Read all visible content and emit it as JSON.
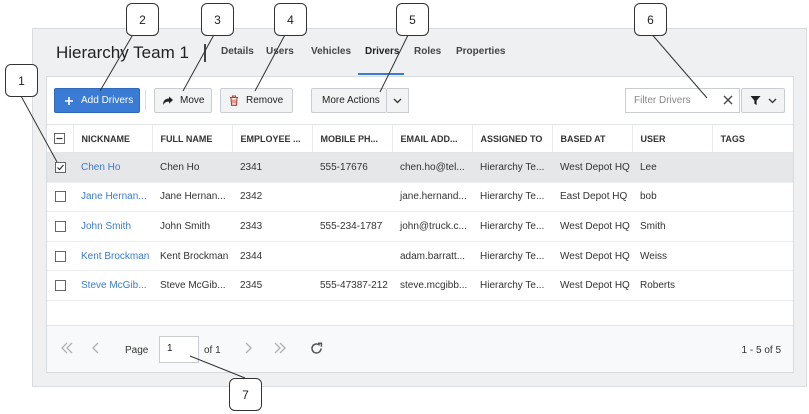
{
  "page": {
    "title": "Hierarchy Team 1"
  },
  "tabs": [
    {
      "label": "Details"
    },
    {
      "label": "Users"
    },
    {
      "label": "Vehicles"
    },
    {
      "label": "Drivers"
    },
    {
      "label": "Roles"
    },
    {
      "label": "Properties"
    }
  ],
  "toolbar": {
    "add_label": "Add Drivers",
    "move_label": "Move",
    "remove_label": "Remove",
    "more_label": "More Actions",
    "filter_placeholder": "Filter Drivers"
  },
  "table": {
    "columns": [
      "NICKNAME",
      "FULL NAME",
      "EMPLOYEE ...",
      "MOBILE PH...",
      "EMAIL ADD...",
      "ASSIGNED TO",
      "BASED AT",
      "USER",
      "TAGS"
    ],
    "rows": [
      {
        "nickname": "Chen Ho",
        "full_name": "Chen Ho",
        "employee": "2341",
        "mobile": "555-17676",
        "email": "chen.ho@tel...",
        "assigned": "Hierarchy Te...",
        "based": "West Depot HQ",
        "user": "Lee",
        "tags": "",
        "checked": true
      },
      {
        "nickname": "Jane Hernan...",
        "full_name": "Jane Hernan...",
        "employee": "2342",
        "mobile": "",
        "email": "jane.hernand...",
        "assigned": "Hierarchy Te...",
        "based": "East Depot HQ",
        "user": "bob",
        "tags": "",
        "checked": false
      },
      {
        "nickname": "John Smith",
        "full_name": "John Smith",
        "employee": "2343",
        "mobile": "555-234-1787",
        "email": "john@truck.c...",
        "assigned": "Hierarchy Te...",
        "based": "West Depot HQ",
        "user": "Smith",
        "tags": "",
        "checked": false
      },
      {
        "nickname": "Kent Brockman",
        "full_name": "Kent Brockman",
        "employee": "2344",
        "mobile": "",
        "email": "adam.barratt...",
        "assigned": "Hierarchy Te...",
        "based": "West Depot HQ",
        "user": "Weiss",
        "tags": "",
        "checked": false
      },
      {
        "nickname": "Steve McGib...",
        "full_name": "Steve McGib...",
        "employee": "2345",
        "mobile": "555-47387-212",
        "email": "steve.mcgibb...",
        "assigned": "Hierarchy Te...",
        "based": "West Depot HQ",
        "user": "Roberts",
        "tags": "",
        "checked": false
      }
    ]
  },
  "pager": {
    "page_label": "Page",
    "page_value": "1",
    "of_label": "of 1",
    "count_label": "1 - 5 of 5"
  },
  "callouts": [
    "1",
    "2",
    "3",
    "4",
    "5",
    "6",
    "7"
  ],
  "icons": {
    "add": "plus-icon",
    "move": "share-arrow-icon",
    "remove": "trash-icon",
    "more": "chevron-down-icon",
    "filter": "funnel-icon",
    "clear": "close-icon",
    "refresh": "refresh-icon"
  },
  "colors": {
    "accent": "#3a7bd5",
    "selected_row": "#e6e7e9"
  }
}
